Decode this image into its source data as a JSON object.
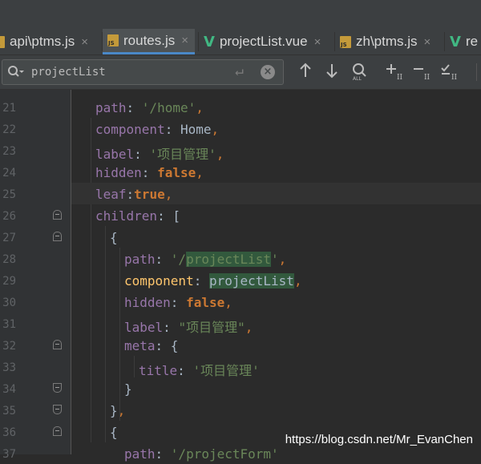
{
  "tabs": [
    {
      "label": "api\\ptms.js",
      "icon": "js-file-icon"
    },
    {
      "label": "routes.js",
      "icon": "js-file-icon",
      "active": true
    },
    {
      "label": "projectList.vue",
      "icon": "vue-file-icon"
    },
    {
      "label": "zh\\ptms.js",
      "icon": "js-file-icon"
    },
    {
      "label": "re",
      "icon": "vue-file-icon"
    }
  ],
  "tab_close_glyph": "×",
  "search": {
    "value": "projectList",
    "icons": [
      "search-icon",
      "enter-icon",
      "clear-icon",
      "arrow-up-icon",
      "arrow-down-icon",
      "select-all-occurrences-icon",
      "add-selection-icon",
      "remove-selection-icon",
      "select-all-checkbox-icon"
    ]
  },
  "lines": [
    {
      "num": "21",
      "indent": 1,
      "tokens": [
        [
          "k",
          "path"
        ],
        [
          "p",
          ": "
        ],
        [
          "s",
          "'/home'"
        ],
        [
          "c",
          ","
        ]
      ]
    },
    {
      "num": "22",
      "indent": 1,
      "tokens": [
        [
          "k",
          "component"
        ],
        [
          "p",
          ": Home"
        ],
        [
          "c",
          ","
        ]
      ]
    },
    {
      "num": "23",
      "indent": 1,
      "tokens": [
        [
          "k",
          "label"
        ],
        [
          "p",
          ": "
        ],
        [
          "s",
          "'项目管理'"
        ],
        [
          "c",
          ","
        ]
      ]
    },
    {
      "num": "24",
      "indent": 1,
      "tokens": [
        [
          "k",
          "hidden"
        ],
        [
          "p",
          ": "
        ],
        [
          "b",
          "false"
        ],
        [
          "c",
          ","
        ]
      ]
    },
    {
      "num": "25",
      "indent": 1,
      "tokens": [
        [
          "k",
          "leaf"
        ],
        [
          "p",
          ":"
        ],
        [
          "b",
          "true"
        ],
        [
          "c",
          ","
        ]
      ],
      "current": true
    },
    {
      "num": "26",
      "indent": 1,
      "tokens": [
        [
          "k",
          "children"
        ],
        [
          "p",
          ": ["
        ]
      ],
      "fold": "down"
    },
    {
      "num": "27",
      "indent": 2,
      "tokens": [
        [
          "p",
          "{"
        ]
      ],
      "fold": "down"
    },
    {
      "num": "28",
      "indent": 3,
      "tokens": [
        [
          "k",
          "path"
        ],
        [
          "p",
          ": "
        ],
        [
          "s",
          "'/"
        ],
        [
          "s-hl",
          "projectList"
        ],
        [
          "s",
          "'"
        ],
        [
          "c",
          ","
        ]
      ]
    },
    {
      "num": "29",
      "indent": 3,
      "tokens": [
        [
          "i",
          "component"
        ],
        [
          "p",
          ": "
        ],
        [
          "p-hl",
          "projectList"
        ],
        [
          "c",
          ","
        ]
      ]
    },
    {
      "num": "30",
      "indent": 3,
      "tokens": [
        [
          "k",
          "hidden"
        ],
        [
          "p",
          ": "
        ],
        [
          "b",
          "false"
        ],
        [
          "c",
          ","
        ]
      ]
    },
    {
      "num": "31",
      "indent": 3,
      "tokens": [
        [
          "k",
          "label"
        ],
        [
          "p",
          ": "
        ],
        [
          "s",
          "\"项目管理\""
        ],
        [
          "c",
          ","
        ]
      ]
    },
    {
      "num": "32",
      "indent": 3,
      "tokens": [
        [
          "k",
          "meta"
        ],
        [
          "p",
          ": {"
        ]
      ],
      "fold": "down"
    },
    {
      "num": "33",
      "indent": 4,
      "tokens": [
        [
          "k",
          "title"
        ],
        [
          "p",
          ": "
        ],
        [
          "s",
          "'项目管理'"
        ]
      ]
    },
    {
      "num": "34",
      "indent": 3,
      "tokens": [
        [
          "p",
          "}"
        ]
      ],
      "fold": "up"
    },
    {
      "num": "35",
      "indent": 2,
      "tokens": [
        [
          "p",
          "}"
        ],
        [
          "c",
          ","
        ]
      ],
      "fold": "up"
    },
    {
      "num": "36",
      "indent": 2,
      "tokens": [
        [
          "p",
          "{"
        ]
      ],
      "fold": "down"
    },
    {
      "num": "37",
      "indent": 3,
      "tokens": [
        [
          "k",
          "path"
        ],
        [
          "p",
          ": "
        ],
        [
          "s",
          "'/projectForm'"
        ]
      ]
    }
  ],
  "watermark": "https://blog.csdn.net/Mr_EvanChen",
  "colors": {
    "background": "#2b2b2b",
    "keyword_purple": "#9876aa",
    "string_green": "#6a8759",
    "boolean_orange": "#cc7832",
    "match_highlight": "#32593d",
    "active_tab_underline": "#4a88c7"
  }
}
